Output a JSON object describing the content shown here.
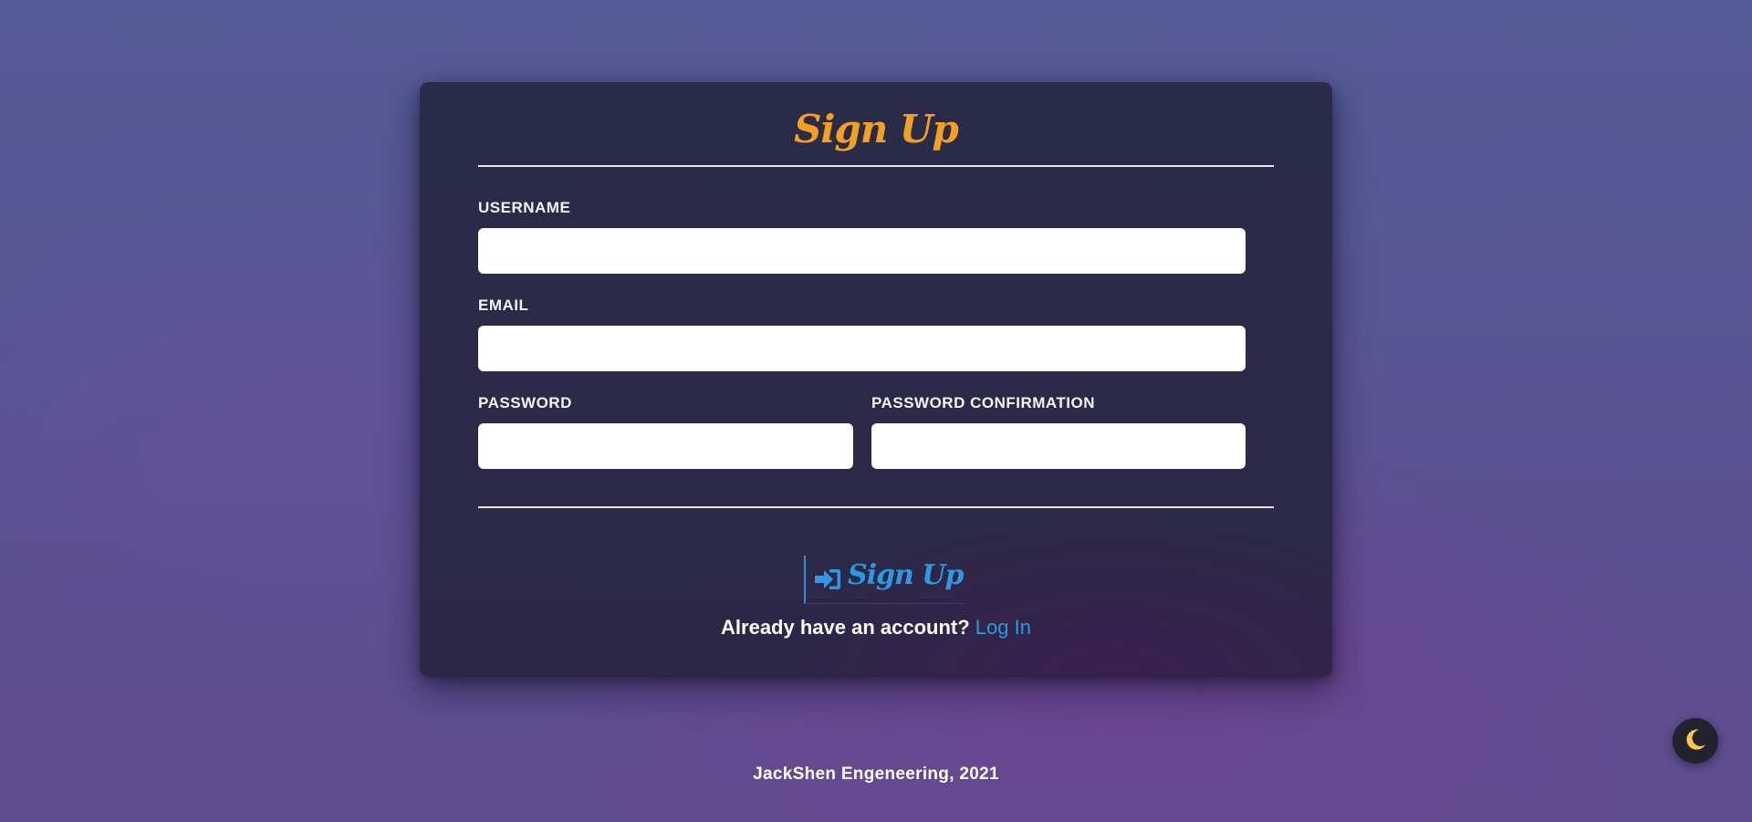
{
  "form": {
    "title": "Sign Up",
    "fields": {
      "username": {
        "label": "USERNAME",
        "value": "",
        "placeholder": ""
      },
      "email": {
        "label": "EMAIL",
        "value": "",
        "placeholder": ""
      },
      "password": {
        "label": "PASSWORD",
        "value": "",
        "placeholder": ""
      },
      "password_confirmation": {
        "label": "PASSWORD CONFIRMATION",
        "value": "",
        "placeholder": ""
      }
    },
    "submit_label": "Sign Up",
    "submit_icon": "sign-in-icon",
    "switch_text": "Already have an account?",
    "login_link": "Log In"
  },
  "footer": {
    "text": "JackShen Engeneering, 2021"
  },
  "theme_toggle": {
    "icon": "moon-icon"
  },
  "colors": {
    "title_accent": "#f5a11f",
    "link_blue": "#2c9ae2",
    "card_background": "#2b2947",
    "moon_yellow": "#f7c948"
  }
}
